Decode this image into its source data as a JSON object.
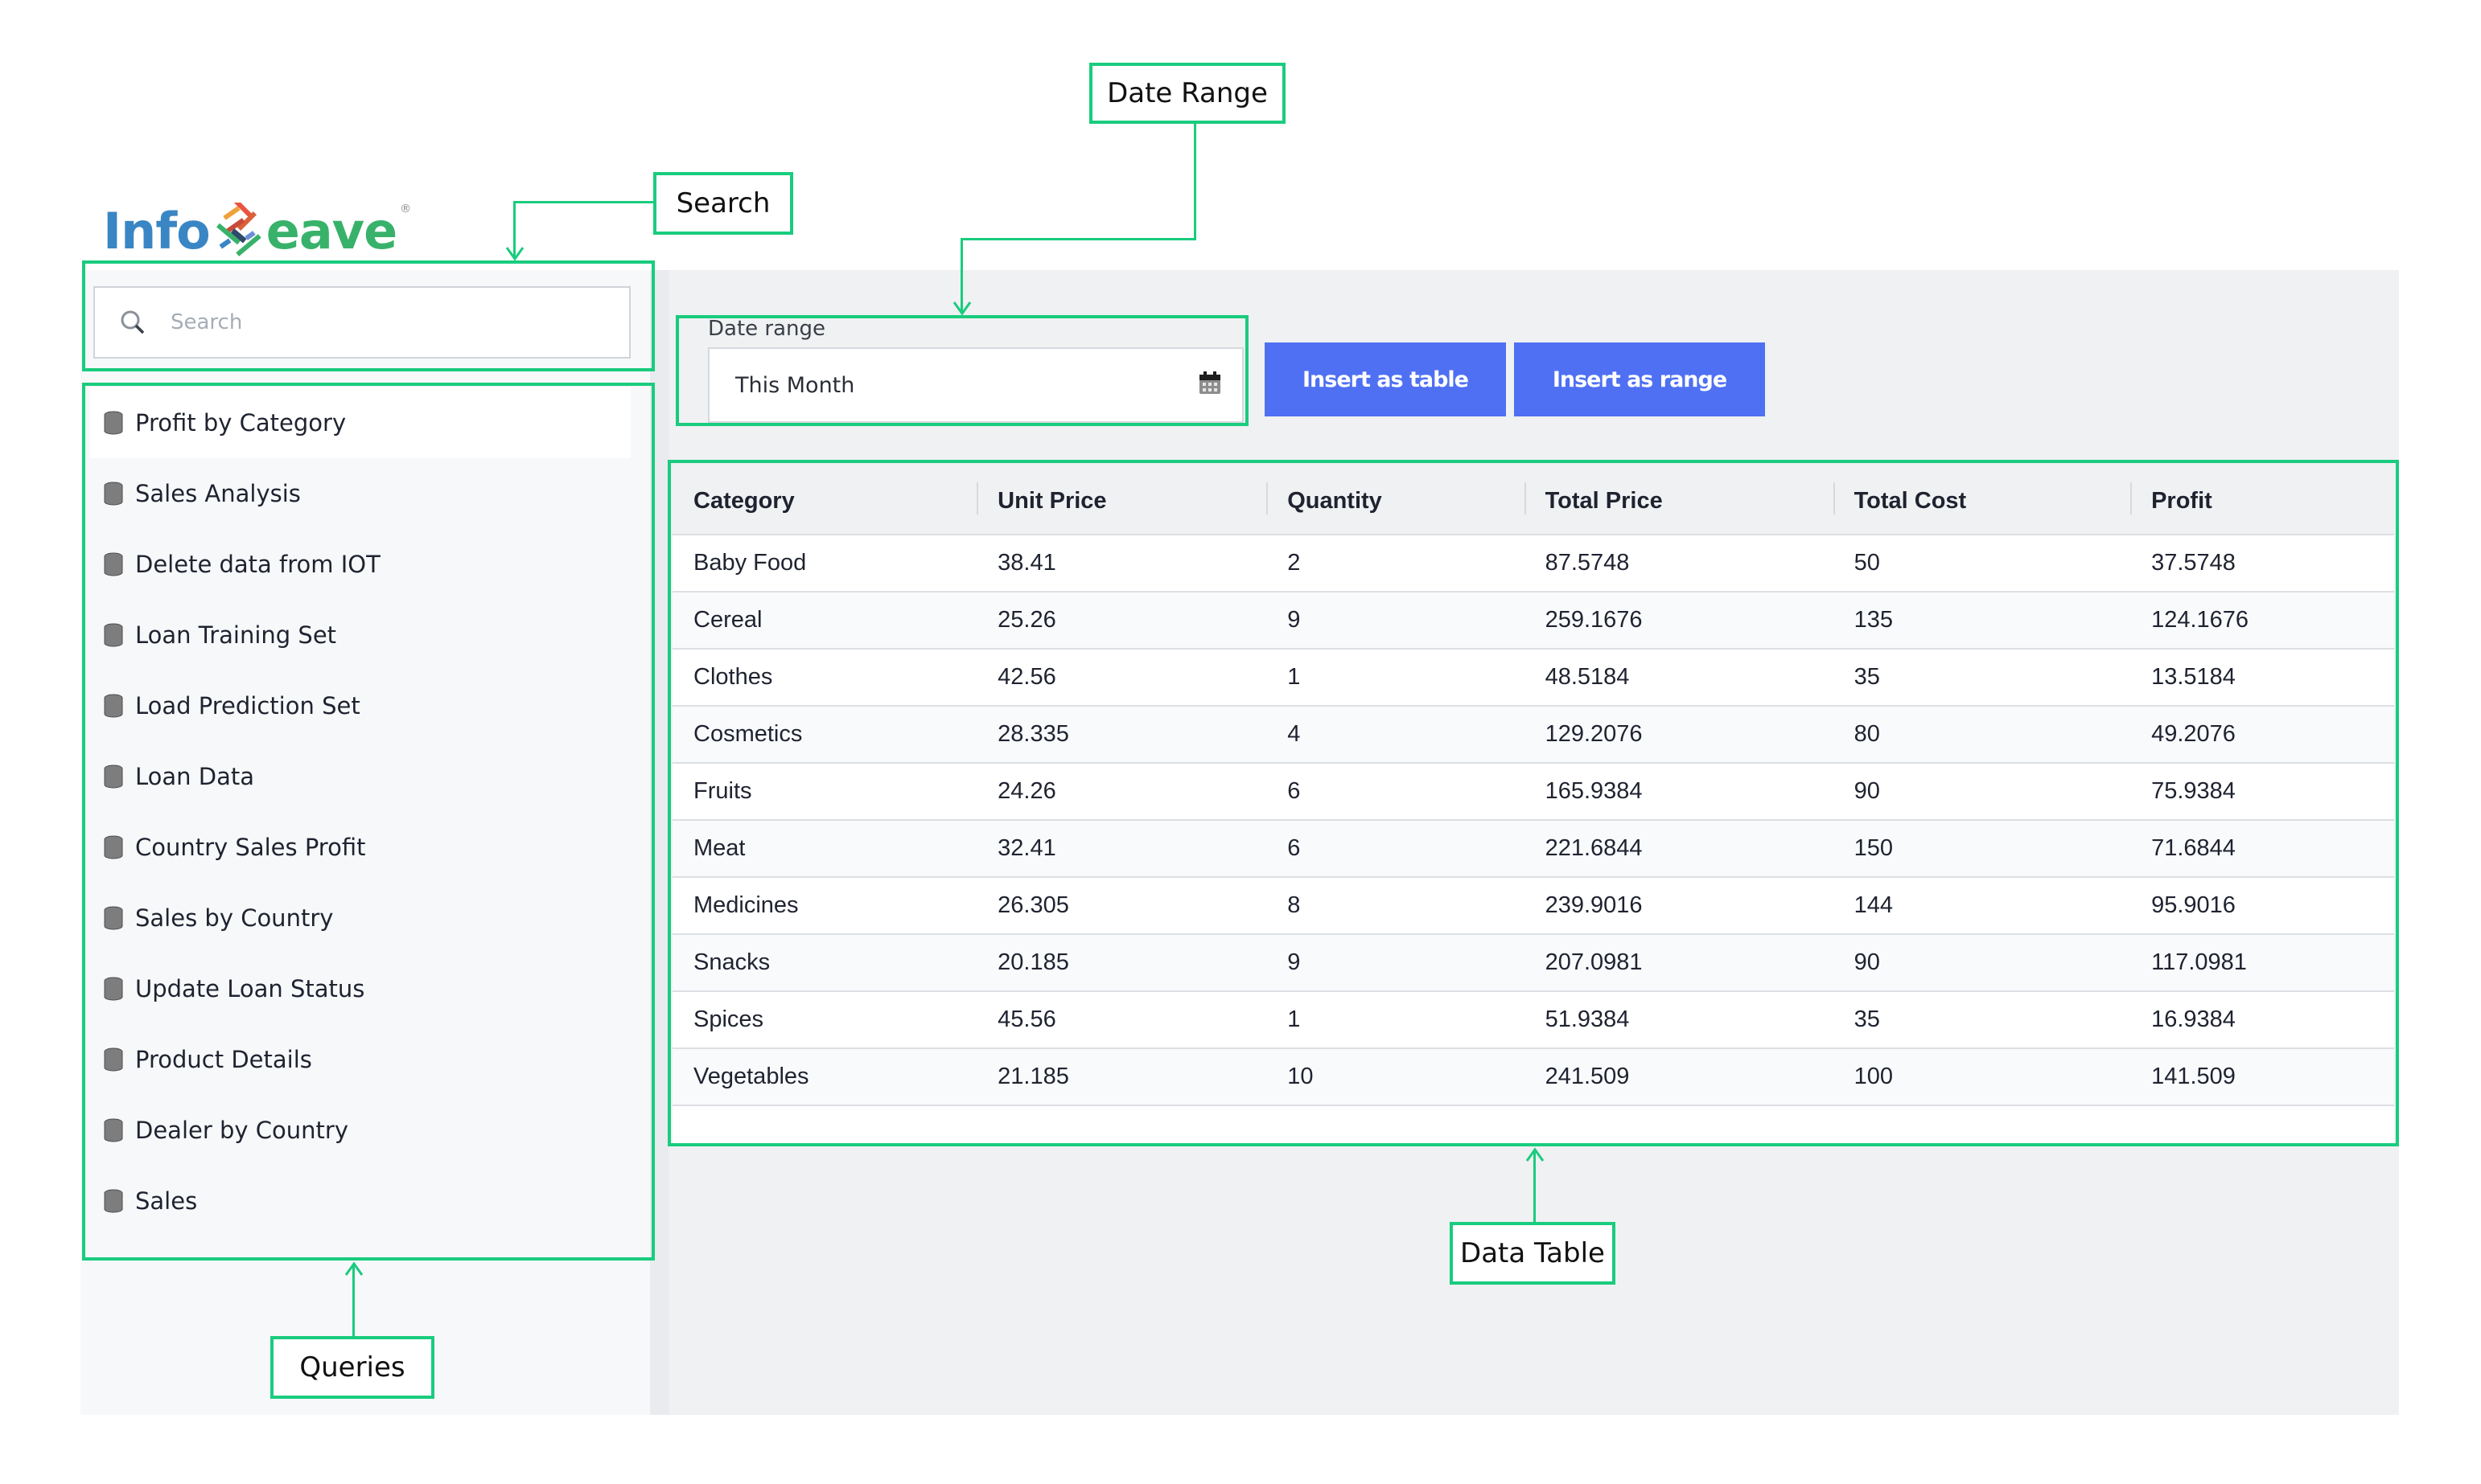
{
  "app": {
    "logo_text_left": "Info",
    "logo_text_right": "eave",
    "logo_registered": "®"
  },
  "sidebar": {
    "search": {
      "placeholder": "Search",
      "value": ""
    },
    "queries": [
      {
        "label": "Profit by Category",
        "icon": "database-icon",
        "active": true
      },
      {
        "label": "Sales Analysis",
        "icon": "database-icon"
      },
      {
        "label": "Delete data from IOT",
        "icon": "database-icon"
      },
      {
        "label": "Loan Training Set",
        "icon": "database-icon"
      },
      {
        "label": "Load Prediction Set",
        "icon": "database-icon"
      },
      {
        "label": "Loan Data",
        "icon": "database-icon"
      },
      {
        "label": "Country Sales Profit",
        "icon": "database-icon"
      },
      {
        "label": "Sales by Country",
        "icon": "database-icon"
      },
      {
        "label": "Update Loan Status",
        "icon": "database-icon"
      },
      {
        "label": "Product Details",
        "icon": "database-icon"
      },
      {
        "label": "Dealer by Country",
        "icon": "database-icon"
      },
      {
        "label": "Sales",
        "icon": "database-icon"
      }
    ]
  },
  "toolbar": {
    "date_range_label": "Date range",
    "date_range_value": "This Month",
    "date_range_icon": "calendar-icon",
    "insert_table_label": "Insert as table",
    "insert_range_label": "Insert as range",
    "button_color": "#4f70f3"
  },
  "table": {
    "columns": [
      "Category",
      "Unit Price",
      "Quantity",
      "Total Price",
      "Total Cost",
      "Profit"
    ],
    "rows": [
      [
        "Baby Food",
        "38.41",
        "2",
        "87.5748",
        "50",
        "37.5748"
      ],
      [
        "Cereal",
        "25.26",
        "9",
        "259.1676",
        "135",
        "124.1676"
      ],
      [
        "Clothes",
        "42.56",
        "1",
        "48.5184",
        "35",
        "13.5184"
      ],
      [
        "Cosmetics",
        "28.335",
        "4",
        "129.2076",
        "80",
        "49.2076"
      ],
      [
        "Fruits",
        "24.26",
        "6",
        "165.9384",
        "90",
        "75.9384"
      ],
      [
        "Meat",
        "32.41",
        "6",
        "221.6844",
        "150",
        "71.6844"
      ],
      [
        "Medicines",
        "26.305",
        "8",
        "239.9016",
        "144",
        "95.9016"
      ],
      [
        "Snacks",
        "20.185",
        "9",
        "207.0981",
        "90",
        "117.0981"
      ],
      [
        "Spices",
        "45.56",
        "1",
        "51.9384",
        "35",
        "16.9384"
      ],
      [
        "Vegetables",
        "21.185",
        "10",
        "241.509",
        "100",
        "141.509"
      ]
    ]
  },
  "annotations": {
    "search": "Search",
    "date_range": "Date Range",
    "queries": "Queries",
    "data_table": "Data Table",
    "color": "#19cc7e"
  }
}
